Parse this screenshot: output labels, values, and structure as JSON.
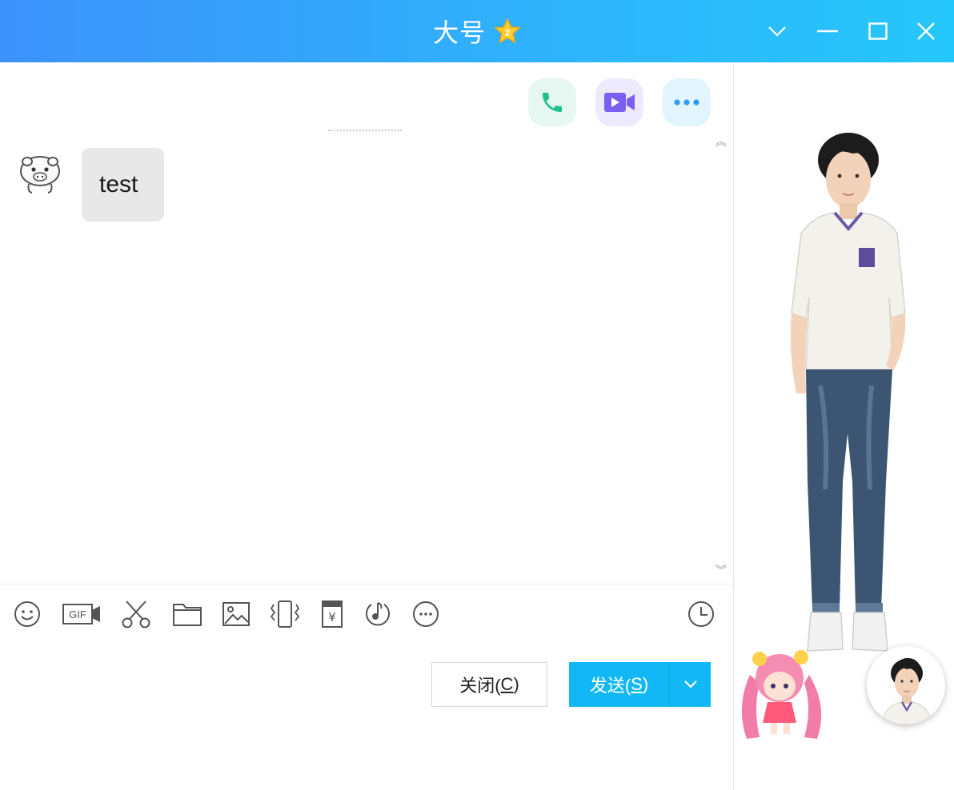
{
  "window": {
    "title": "大号",
    "vip_level": "2"
  },
  "chat": {
    "messages": [
      {
        "text": "test"
      }
    ]
  },
  "toolbar": {
    "gif_label": "GIF"
  },
  "buttons": {
    "close_text": "关闭(",
    "close_key": "C",
    "close_end": ")",
    "send_text": "发送(",
    "send_key": "S",
    "send_end": ")"
  },
  "colors": {
    "titlebar_start": "#3c92fb",
    "titlebar_end": "#25c7fb",
    "send_button": "#12b7f5",
    "bubble_bg": "#e8e8e8"
  },
  "icons": {
    "window_controls": [
      "chevron-down-icon",
      "minimize-icon",
      "maximize-icon",
      "close-icon"
    ],
    "call_actions": [
      "phone-icon",
      "video-icon",
      "more-icon"
    ],
    "tools": [
      "emoji-icon",
      "gif-icon",
      "screenshot-icon",
      "folder-icon",
      "image-icon",
      "shake-icon",
      "red-packet-icon",
      "music-icon",
      "more-tools-icon",
      "history-icon"
    ]
  }
}
